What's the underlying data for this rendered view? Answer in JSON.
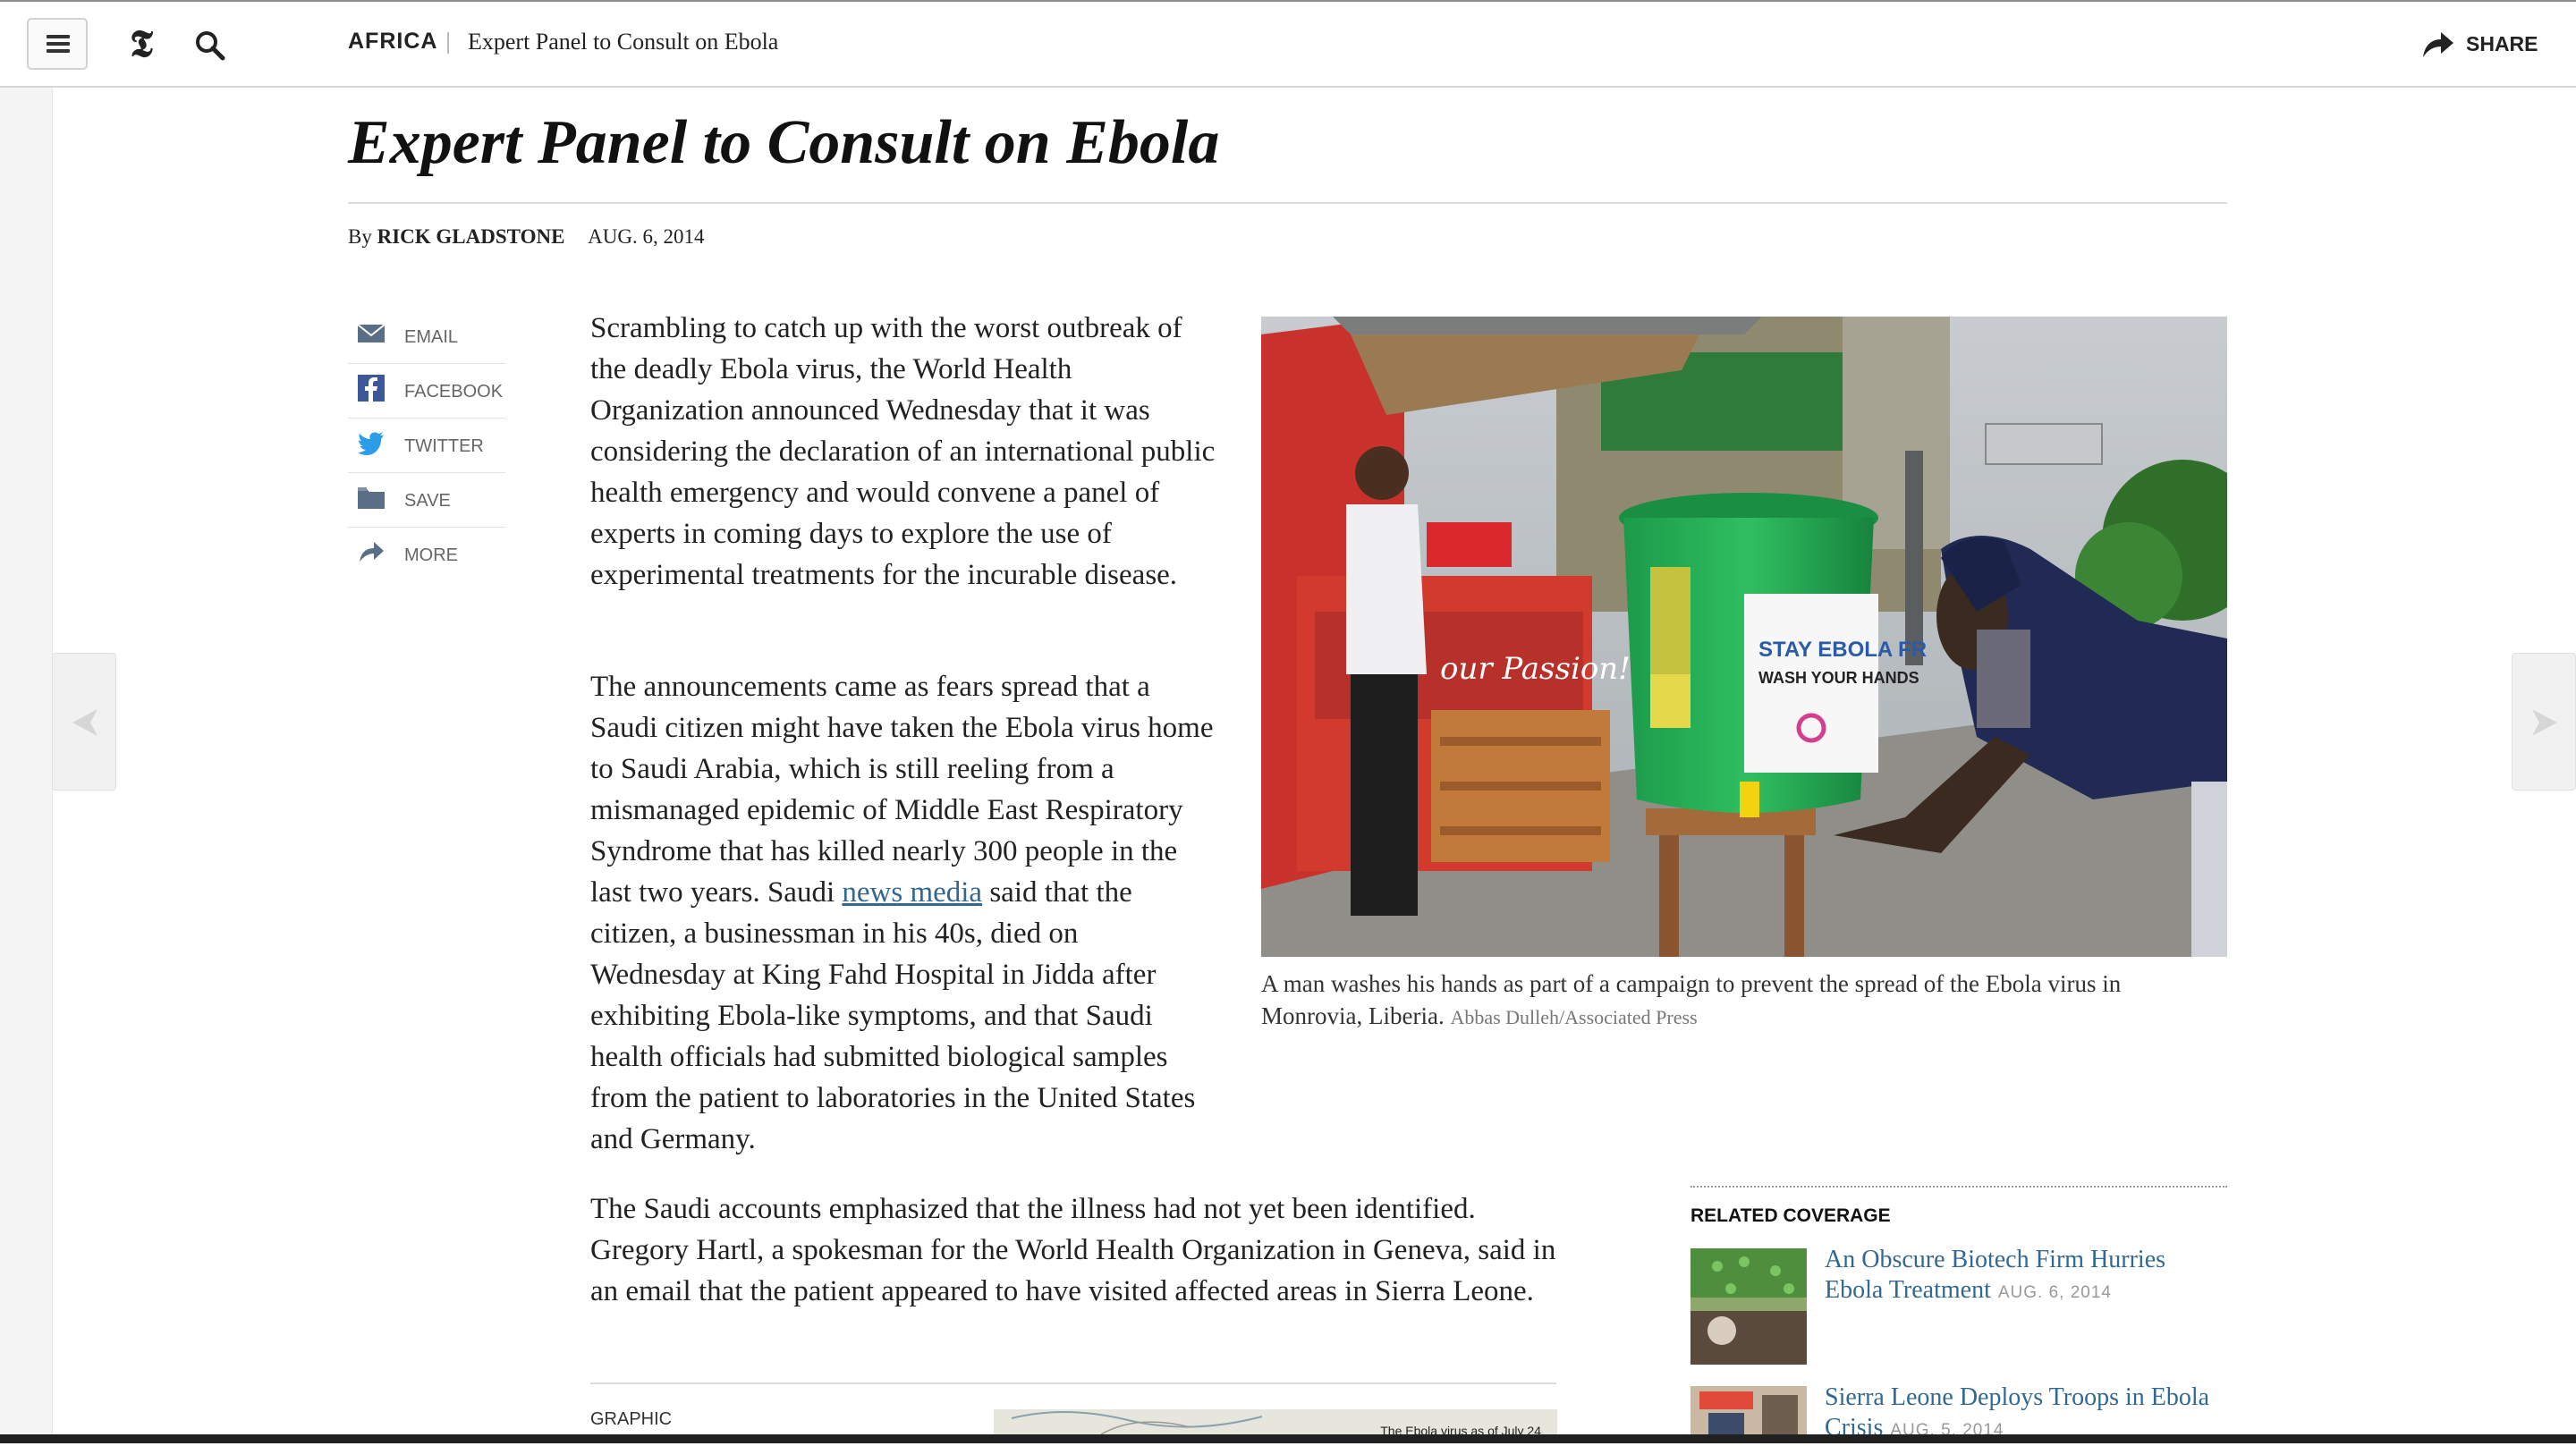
{
  "header": {
    "section": "AFRICA",
    "crumb_title": "Expert Panel to Consult on Ebola",
    "share_label": "SHARE",
    "icons": [
      "menu-icon",
      "nyt-logo-icon",
      "search-icon",
      "share-arrow-icon"
    ]
  },
  "article": {
    "headline": "Expert Panel to Consult on Ebola",
    "byline_prefix": "By",
    "author": "RICK GLADSTONE",
    "date": "AUG. 6, 2014",
    "p1": "Scrambling to catch up with the worst outbreak of the deadly Ebola virus, the World Health Organization announced Wednesday that it was considering the declaration of an international public health emergency and would convene a panel of experts in coming days to explore the use of experimental treatments for the incurable disease.",
    "p2_before": "The announcements came as fears spread that a Saudi citizen might have taken the Ebola virus home to Saudi Arabia, which is still reeling from a mismanaged epidemic of Middle East Respiratory Syndrome that has killed nearly 300 people in the last two years. Saudi ",
    "p2_link": "news media",
    "p2_after": " said that the citizen, a businessman in his 40s, died on Wednesday at King Fahd Hospital in Jidda after exhibiting Ebola-like symptoms, and that Saudi health officials had submitted biological samples from the patient to laboratories in the United States and Germany.",
    "p3": "The Saudi accounts emphasized that the illness had not yet been identified. Gregory Hartl, a spokesman for the World Health Organization in Geneva, said in an email that the patient appeared to have visited affected areas in Sierra Leone."
  },
  "social": {
    "items": [
      {
        "label": "EMAIL",
        "icon": "email-icon"
      },
      {
        "label": "FACEBOOK",
        "icon": "facebook-icon"
      },
      {
        "label": "TWITTER",
        "icon": "twitter-icon"
      },
      {
        "label": "SAVE",
        "icon": "save-icon"
      },
      {
        "label": "MORE",
        "icon": "more-arrow-icon"
      }
    ]
  },
  "photo": {
    "caption": "A man washes his hands as part of a campaign to prevent the spread of the Ebola virus in Monrovia, Liberia.",
    "credit": "Abbas Dulleh/Associated Press",
    "bucket_sign_line1": "STAY EBOLA FR",
    "bucket_sign_line2": "WASH YOUR HANDS",
    "stall_text": "our Passion!"
  },
  "related": {
    "title": "RELATED COVERAGE",
    "items": [
      {
        "title": "An Obscure Biotech Firm Hurries Ebola Treatment",
        "date": "AUG. 6, 2014"
      },
      {
        "title": "Sierra Leone Deploys Troops in Ebola Crisis",
        "date": "AUG. 5, 2014"
      }
    ]
  },
  "graphic": {
    "label": "GRAPHIC",
    "map_caption": "The Ebola virus as of July 24"
  },
  "navigation": {
    "prev_icon": "chevron-left-icon",
    "next_icon": "chevron-right-icon"
  },
  "colors": {
    "link": "#326891",
    "text": "#222222",
    "muted": "#666666",
    "rule": "#dcdcdc"
  }
}
